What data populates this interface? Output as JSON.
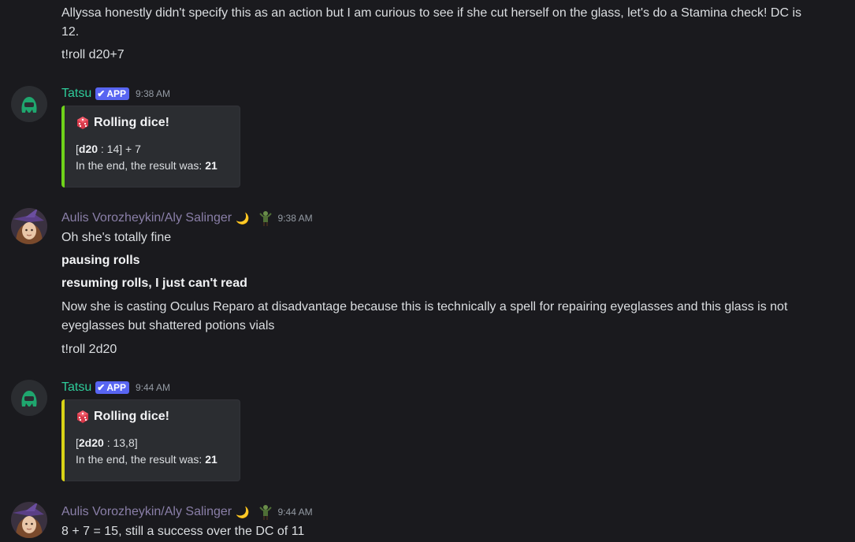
{
  "messages": {
    "top_text_1": "Allyssa honestly didn't specify this as an action but I am curious to see if she cut herself on the glass, let's do a Stamina check! DC is",
    "top_text_2": "12.",
    "top_roll": "t!roll d20+7",
    "bot_1": {
      "username": "Tatsu",
      "badge": "APP",
      "time": "9:38 AM",
      "embed_title": "Rolling dice!",
      "roll_open": "[",
      "roll_die": "d20",
      "roll_rest": " : 14] + 7",
      "result_prefix": "In the end, the result was: ",
      "result_value": "21",
      "bar_color": "#6fd31a"
    },
    "user_1": {
      "username": "Aulis Vorozheykin/Aly Salinger",
      "moon": "🌙",
      "time": "9:38 AM",
      "line_1": "Oh she's totally fine",
      "line_2": "pausing rolls",
      "line_3": "resuming rolls, I just can't read",
      "line_4": "Now she is casting Oculus Reparo at disadvantage because this is technically a spell for repairing eyeglasses and this glass is not",
      "line_5": "eyeglasses but shattered potions vials",
      "line_6": "t!roll 2d20"
    },
    "bot_2": {
      "username": "Tatsu",
      "badge": "APP",
      "time": "9:44 AM",
      "embed_title": "Rolling dice!",
      "roll_open": "[",
      "roll_die": "2d20",
      "roll_rest": " : 13,8]",
      "result_prefix": "In the end, the result was: ",
      "result_value": "21",
      "bar_color": "#d9d316"
    },
    "user_2": {
      "username": "Aulis Vorozheykin/Aly Salinger",
      "moon": "🌙",
      "time": "9:44 AM",
      "line_1": "8 + 7 = 15, still a success over the DC of 11"
    }
  },
  "colors": {
    "background": "#1a1a1e",
    "bot_name": "#2ecc9a",
    "user_name": "#8a7fa8",
    "app_badge": "#5865f2"
  },
  "icons": {
    "bot_avatar": "green-blob-avatar",
    "user_avatar": "witch-portrait-avatar",
    "dice": "red-dice-icon",
    "check": "checkmark-icon",
    "role": "green-figure-icon"
  }
}
